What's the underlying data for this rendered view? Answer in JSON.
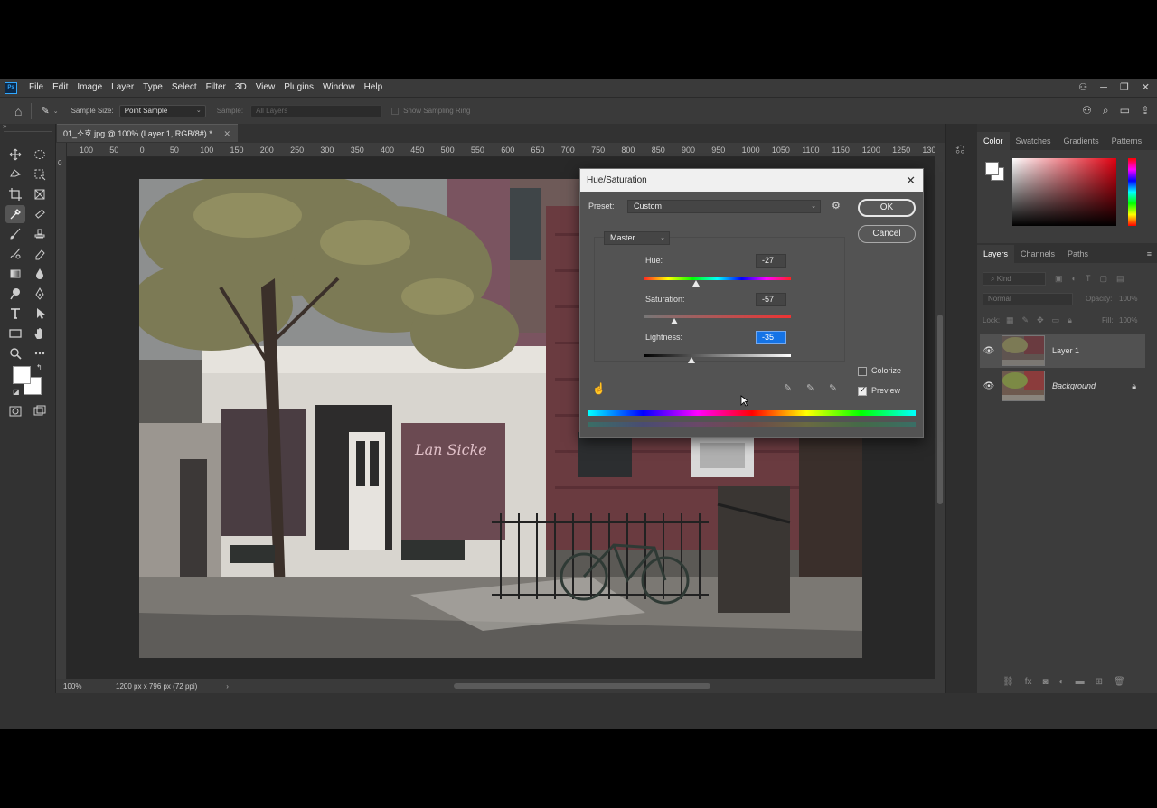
{
  "menubar": {
    "logo": "Ps",
    "items": [
      "File",
      "Edit",
      "Image",
      "Layer",
      "Type",
      "Select",
      "Filter",
      "3D",
      "View",
      "Plugins",
      "Window",
      "Help"
    ]
  },
  "options": {
    "sample_size_label": "Sample Size:",
    "sample_size_value": "Point Sample",
    "sample_label": "Sample:",
    "sample_value": "All Layers",
    "show_ring": "Show Sampling Ring"
  },
  "document": {
    "tab_title": "01_소호.jpg @ 100% (Layer 1, RGB/8#) *",
    "ruler_ticks": [
      "100",
      "50",
      "0",
      "50",
      "100",
      "150",
      "200",
      "250",
      "300",
      "350",
      "400",
      "450",
      "500",
      "550",
      "600",
      "650",
      "700",
      "750",
      "800",
      "850",
      "900",
      "950",
      "1000",
      "1050",
      "1100",
      "1150",
      "1200",
      "1250",
      "130"
    ],
    "zoom": "100%",
    "dimensions": "1200 px x 796 px (72 ppi)"
  },
  "panels": {
    "color_tabs": [
      "Color",
      "Swatches",
      "Gradients",
      "Patterns"
    ],
    "layers_tabs": [
      "Layers",
      "Channels",
      "Paths"
    ],
    "kind_placeholder": "Kind",
    "blend_mode": "Normal",
    "opacity_label": "Opacity:",
    "opacity_value": "100%",
    "lock_label": "Lock:",
    "fill_label": "Fill:",
    "fill_value": "100%",
    "layers": [
      {
        "name": "Layer 1",
        "selected": true
      },
      {
        "name": "Background",
        "locked": true
      }
    ]
  },
  "dialog": {
    "title": "Hue/Saturation",
    "preset_label": "Preset:",
    "preset_value": "Custom",
    "channel": "Master",
    "ok": "OK",
    "cancel": "Cancel",
    "hue_label": "Hue:",
    "hue_value": "-27",
    "saturation_label": "Saturation:",
    "saturation_value": "-57",
    "lightness_label": "Lightness:",
    "lightness_value": "-35",
    "colorize_label": "Colorize",
    "colorize_checked": false,
    "preview_label": "Preview",
    "preview_checked": true
  }
}
